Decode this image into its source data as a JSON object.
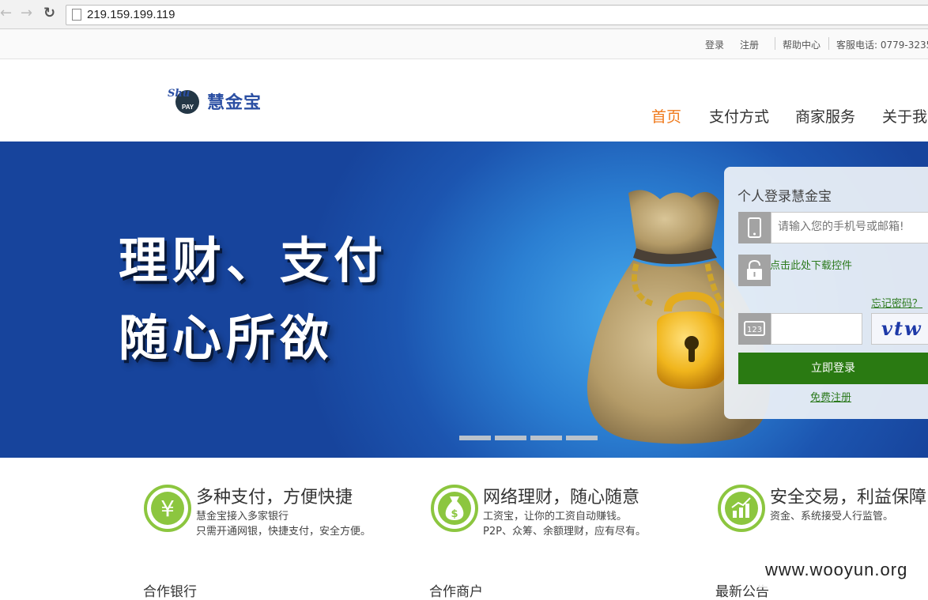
{
  "browser": {
    "url": "219.159.199.119"
  },
  "topbar": {
    "login": "登录",
    "register": "注册",
    "help": "帮助中心",
    "hotline": "客服电话: 0779-3235"
  },
  "brand": {
    "logo_mark_top": "Shu",
    "logo_mark_bottom": "PAY",
    "name": "慧金宝"
  },
  "nav": {
    "items": [
      {
        "label": "首页",
        "active": true
      },
      {
        "label": "支付方式",
        "active": false
      },
      {
        "label": "商家服务",
        "active": false
      },
      {
        "label": "关于我",
        "active": false
      }
    ]
  },
  "banner": {
    "slogan_line1": "理财、支付",
    "slogan_line2": "随心所欲",
    "slide_count": 4
  },
  "login": {
    "title": "个人登录慧金宝",
    "phone_placeholder": "请输入您的手机号或邮箱!",
    "download_control": "点击此处下载控件",
    "forgot": "忘记密码？",
    "captcha_text": "vtw",
    "submit": "立即登录",
    "register": "免费注册"
  },
  "features": [
    {
      "icon": "yen-icon",
      "title": "多种支付，方便快捷",
      "line1": "慧金宝接入多家银行",
      "line2": "只需开通网银，快捷支付，安全方便。"
    },
    {
      "icon": "money-bag-icon",
      "title": "网络理财，随心随意",
      "line1": "工资宝，让你的工资自动赚钱。",
      "line2": "P2P、众筹、余额理财，应有尽有。"
    },
    {
      "icon": "growth-chart-icon",
      "title": "安全交易，利益保障",
      "line1": "资金、系统接受人行监管。",
      "line2": ""
    }
  ],
  "sections": {
    "banks": "合作银行",
    "merchants": "合作商户",
    "notices": "最新公告"
  },
  "watermark": "www.wooyun.org",
  "colors": {
    "accent_orange": "#f07a1c",
    "brand_blue": "#2b4fa3",
    "button_green": "#2a7a12",
    "feature_green": "#8cc63f"
  }
}
